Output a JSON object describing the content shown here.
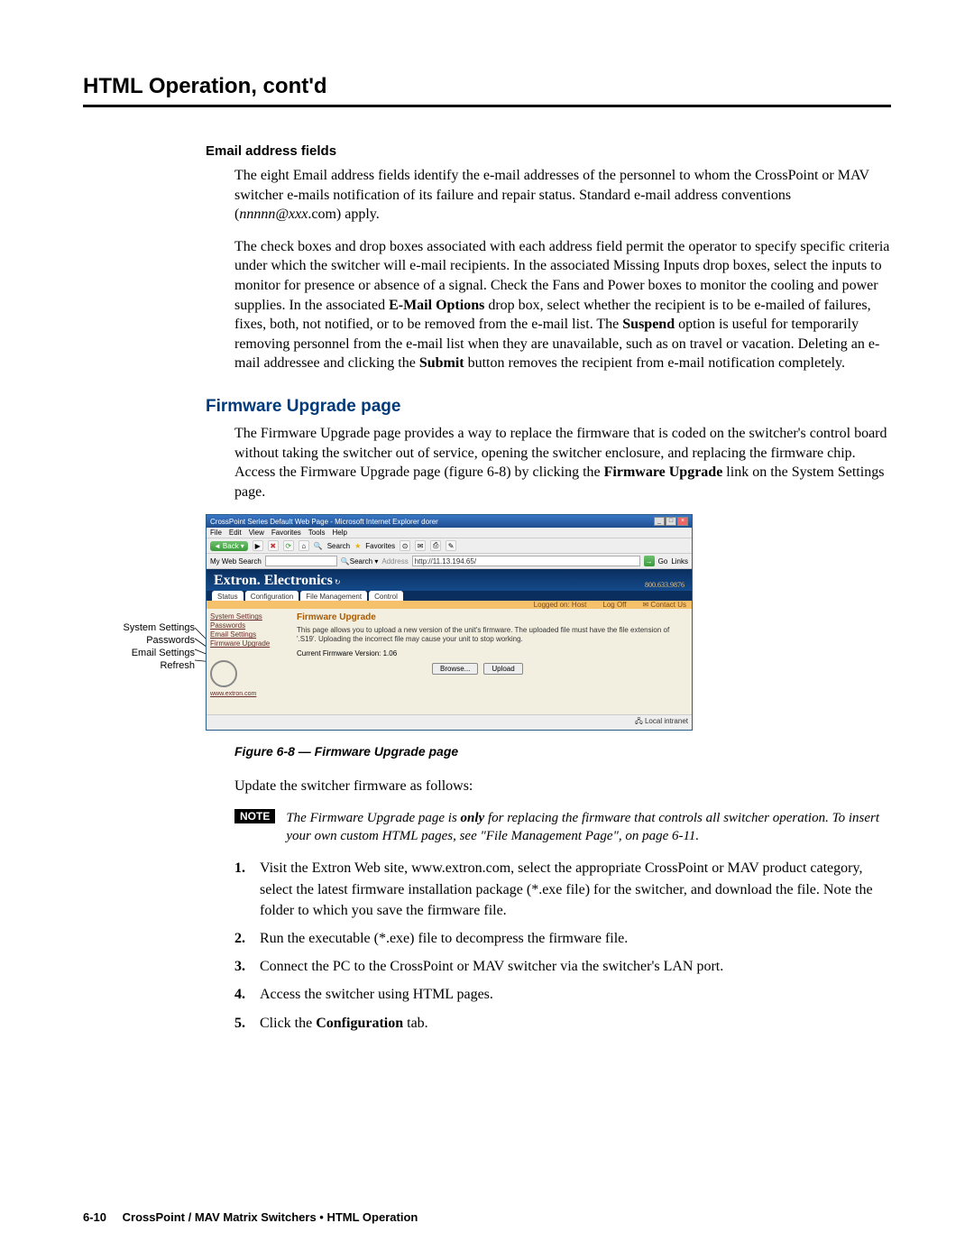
{
  "pageTitle": "HTML Operation, cont'd",
  "sections": {
    "emailFields": {
      "heading": "Email address fields",
      "p1_a": "The eight Email address fields identify the e-mail addresses of the personnel to whom the CrossPoint or MAV switcher e-mails notification of its failure and repair status.  Standard e-mail address conventions (",
      "p1_i": "nnnnn@xxx",
      "p1_b": ".com) apply.",
      "p2_a": "The check boxes and drop boxes associated with each address field permit the operator to specify specific criteria under which the switcher will e-mail recipients.  In the associated Missing Inputs drop boxes, select the inputs to monitor for presence or absence of a signal.  Check the Fans and Power boxes to monitor the cooling and power supplies.  In the associated ",
      "p2_bold1": "E-Mail Options",
      "p2_b": " drop box, select whether the recipient is to be e-mailed of failures, fixes, both, not notified, or to be removed from the e-mail list.  The ",
      "p2_bold2": "Suspend",
      "p2_c": " option is useful for temporarily removing personnel from the e-mail list when they are unavailable, such as on travel or vacation.  Deleting an e-mail addressee and clicking the ",
      "p2_bold3": "Submit",
      "p2_d": " button removes the recipient from e-mail notification completely."
    },
    "firmware": {
      "heading": "Firmware Upgrade page",
      "p1_a": "The Firmware Upgrade page provides a way to replace the firmware that is coded on the switcher's control board without taking the switcher out of service, opening the switcher enclosure, and replacing the firmware chip.  Access the Firmware Upgrade page (figure 6-8) by clicking the ",
      "p1_bold": "Firmware Upgrade",
      "p1_b": " link on the System Settings page.",
      "figureCaption": "Figure 6-8 — Firmware Upgrade page",
      "updateIntro": "Update the switcher firmware as follows:",
      "note_label": "NOTE",
      "note_a": "The Firmware Upgrade page is ",
      "note_bold": "only",
      "note_b": " for replacing the firmware that controls all switcher operation.  To insert your own custom HTML pages, see \"File Management Page\", on page 6-11.",
      "steps": [
        {
          "n": "1.",
          "t": "Visit the Extron Web site, www.extron.com, select the appropriate CrossPoint or MAV product category, select the latest firmware installation package (*.exe file) for the switcher, and download the file.  Note the folder to which you save the firmware file."
        },
        {
          "n": "2.",
          "t": "Run the executable (*.exe) file to decompress the firmware file."
        },
        {
          "n": "3.",
          "t": "Connect the PC to the CrossPoint or MAV switcher via the switcher's LAN port."
        },
        {
          "n": "4.",
          "t": "Access the switcher using HTML pages."
        },
        {
          "n": "5.",
          "t_a": "Click the ",
          "t_bold": "Configuration",
          "t_b": " tab."
        }
      ]
    }
  },
  "callouts": {
    "l1": "System Settings",
    "l2": "Passwords",
    "l3": "Email Settings",
    "l4": "Refresh"
  },
  "browser": {
    "title": "CrossPoint Series Default Web Page - Microsoft Internet Explorer dorer",
    "menu": [
      "File",
      "Edit",
      "View",
      "Favorites",
      "Tools",
      "Help"
    ],
    "back": "Back",
    "searchLabel": "Search",
    "favoritesLabel": "Favorites",
    "mySearch": "My Web Search",
    "searchBtn": "Search",
    "addressLabel": "Address",
    "address": "http://11.13.194.65/",
    "go": "Go",
    "links": "Links",
    "bannerTitle": "Extron. Electronics",
    "bannerPhone": "800.633.9876",
    "tabs": [
      "Status",
      "Configuration",
      "File Management",
      "Control"
    ],
    "strip": {
      "loggedOn": "Logged on: Host",
      "logoff": "Log Off",
      "contact": "Contact Us"
    },
    "sidebar": {
      "items": [
        "System Settings",
        "Passwords",
        "Email Settings",
        "Firmware Upgrade"
      ],
      "url": "www.extron.com"
    },
    "panel": {
      "title": "Firmware Upgrade",
      "desc": "This page allows you to upload a new version of the unit's firmware. The uploaded file must have the file extension of '.S19'. Uploading the incorrect file may cause your unit to stop working.",
      "version": "Current Firmware Version: 1.06",
      "browse": "Browse...",
      "upload": "Upload"
    },
    "status": "Local intranet"
  },
  "footer": {
    "pageNum": "6-10",
    "text": "CrossPoint / MAV Matrix Switchers • HTML Operation"
  }
}
